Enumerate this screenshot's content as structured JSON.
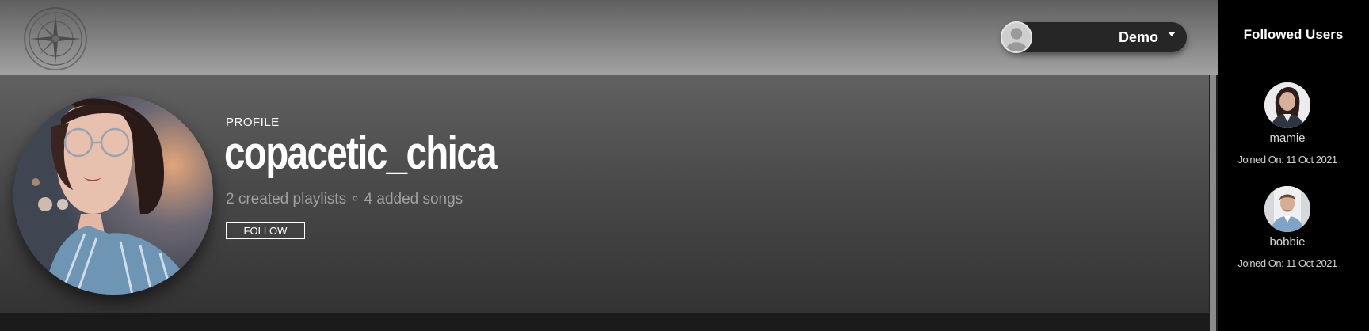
{
  "header": {
    "logo_icon": "compass-rose-logo-icon",
    "user_menu": {
      "avatar_icon": "default-user-avatar-icon",
      "name": "Demo",
      "caret_icon": "caret-down-icon"
    }
  },
  "profile": {
    "kicker": "PROFILE",
    "username": "copacetic_chica",
    "stats": "2 created playlists ∘ 4 added songs",
    "follow_label": "FOLLOW",
    "avatar_icon": "profile-photo"
  },
  "sidebar": {
    "title": "Followed Users",
    "users": [
      {
        "name": "mamie",
        "joined": "Joined On: 11 Oct 2021",
        "avatar_icon": "user-photo"
      },
      {
        "name": "bobbie",
        "joined": "Joined On: 11 Oct 2021",
        "avatar_icon": "user-photo"
      }
    ]
  },
  "colors": {
    "sidebar_bg": "#000000",
    "hero_top": "#616161",
    "hero_bottom": "#333333",
    "user_menu_bg": "#262626"
  }
}
